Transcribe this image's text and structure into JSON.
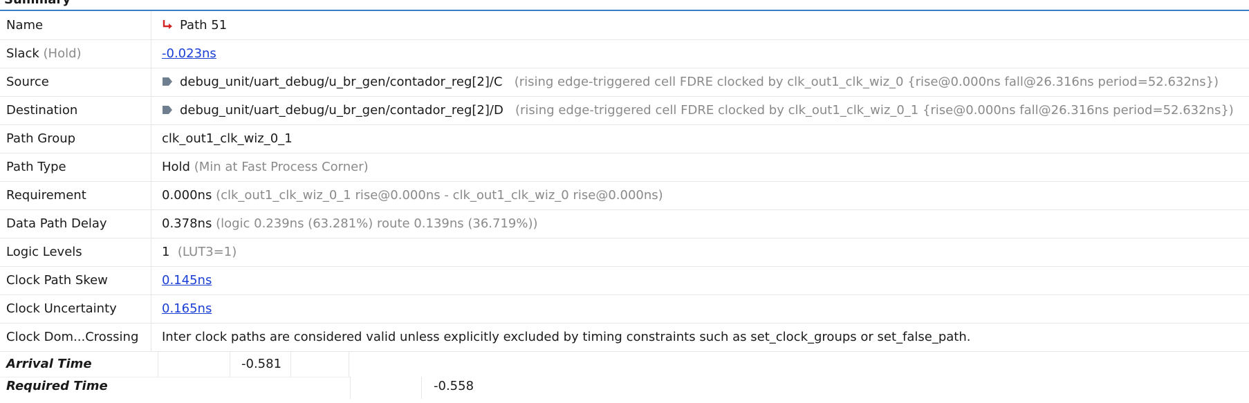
{
  "section_title": "Summary",
  "rows": {
    "name": {
      "label": "Name",
      "value": "Path 51"
    },
    "slack": {
      "label": "Slack",
      "qualifier": "(Hold)",
      "value": "-0.023ns"
    },
    "source": {
      "label": "Source",
      "value": "debug_unit/uart_debug/u_br_gen/contador_reg[2]/C",
      "detail": "(rising edge-triggered cell FDRE clocked by clk_out1_clk_wiz_0  {rise@0.000ns fall@26.316ns period=52.632ns})"
    },
    "destination": {
      "label": "Destination",
      "value": "debug_unit/uart_debug/u_br_gen/contador_reg[2]/D",
      "detail": "(rising edge-triggered cell FDRE clocked by clk_out1_clk_wiz_0_1  {rise@0.000ns fall@26.316ns period=52.632ns})"
    },
    "path_group": {
      "label": "Path Group",
      "value": "clk_out1_clk_wiz_0_1"
    },
    "path_type": {
      "label": "Path Type",
      "value": "Hold",
      "detail": "(Min at Fast Process Corner)"
    },
    "requirement": {
      "label": "Requirement",
      "value": "0.000ns",
      "detail": "(clk_out1_clk_wiz_0_1 rise@0.000ns - clk_out1_clk_wiz_0 rise@0.000ns)"
    },
    "data_path_delay": {
      "label": "Data Path Delay",
      "value": "0.378ns",
      "detail": "(logic 0.239ns (63.281%)  route 0.139ns (36.719%))"
    },
    "logic_levels": {
      "label": "Logic Levels",
      "value": "1",
      "detail": "(LUT3=1)"
    },
    "clock_path_skew": {
      "label": "Clock Path Skew",
      "value": "0.145ns"
    },
    "clock_uncertainty": {
      "label": "Clock Uncertainty",
      "value": "0.165ns"
    },
    "clock_domain_crossing": {
      "label": "Clock Dom...Crossing",
      "value": "Inter clock paths are considered valid unless explicitly excluded by timing constraints such as set_clock_groups or set_false_path."
    }
  },
  "times": {
    "arrival": {
      "label": "Arrival Time",
      "value": "-0.581"
    },
    "required": {
      "label": "Required Time",
      "value": "-0.558"
    }
  },
  "colors": {
    "link": "#1a3fd6",
    "muted": "#8a8a8a",
    "path_icon": "#d22424",
    "pin_icon": "#6f7f8f",
    "header_rule": "#3b7dc4"
  },
  "icons": {
    "name": "path-arrow-icon",
    "source": "pin-icon",
    "destination": "pin-icon"
  }
}
